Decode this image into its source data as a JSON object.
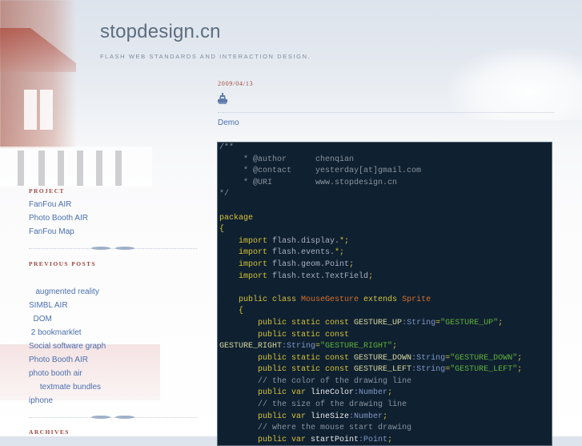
{
  "site": {
    "title": "stopdesign.cn",
    "tagline": "FLASH WEB STANDARDS AND INTERACTION DESIGN."
  },
  "sidebar": {
    "project": {
      "heading": "PROJECT",
      "items": [
        "FanFou AIR",
        "Photo Booth AIR",
        "FanFou Map"
      ]
    },
    "previous_posts": {
      "heading": "PREVIOUS POSTS",
      "items": [
        "   augmented reality",
        "SIMBL AIR",
        "  DOM",
        " 2 bookmarklet",
        "Social software graph",
        "Photo Booth AIR",
        "photo booth air",
        "     textmate bundles",
        "iphone"
      ]
    },
    "archives": {
      "heading": "ARCHIVES"
    }
  },
  "post": {
    "date": "2009/04/13",
    "icon": "pavilion-icon",
    "title": "Demo",
    "code_lines": [
      [
        [
          "comment",
          "/**"
        ]
      ],
      [
        [
          "comment",
          "     * @author      chenqian"
        ]
      ],
      [
        [
          "comment",
          "     * @contact     yesterday[at]gmail.com"
        ]
      ],
      [
        [
          "comment",
          "     * @URI         www.stopdesign.cn"
        ]
      ],
      [
        [
          "comment",
          "*/"
        ]
      ],
      [
        [
          "plain",
          ""
        ]
      ],
      [
        [
          "kw",
          "package"
        ]
      ],
      [
        [
          "punc",
          "{"
        ]
      ],
      [
        [
          "plain",
          "    "
        ],
        [
          "kw",
          "import"
        ],
        [
          "plain",
          " flash.display."
        ],
        [
          "punc",
          "*;"
        ]
      ],
      [
        [
          "plain",
          "    "
        ],
        [
          "kw",
          "import"
        ],
        [
          "plain",
          " flash.events."
        ],
        [
          "punc",
          "*;"
        ]
      ],
      [
        [
          "plain",
          "    "
        ],
        [
          "kw",
          "import"
        ],
        [
          "plain",
          " flash.geom.Point"
        ],
        [
          "punc",
          ";"
        ]
      ],
      [
        [
          "plain",
          "    "
        ],
        [
          "kw",
          "import"
        ],
        [
          "plain",
          " flash.text.TextField"
        ],
        [
          "punc",
          ";"
        ]
      ],
      [
        [
          "plain",
          ""
        ]
      ],
      [
        [
          "plain",
          "    "
        ],
        [
          "kw",
          "public class "
        ],
        [
          "cls",
          "MouseGesture"
        ],
        [
          "kw",
          " extends "
        ],
        [
          "cls",
          "Sprite"
        ]
      ],
      [
        [
          "plain",
          "    "
        ],
        [
          "punc",
          "{"
        ]
      ],
      [
        [
          "plain",
          "        "
        ],
        [
          "kw",
          "public static const "
        ],
        [
          "id",
          "GESTURE_UP"
        ],
        [
          "type",
          ":String"
        ],
        [
          "punc",
          "="
        ],
        [
          "str",
          "\"GESTURE_UP\""
        ],
        [
          "punc",
          ";"
        ]
      ],
      [
        [
          "plain",
          "        "
        ],
        [
          "kw",
          "public static const"
        ]
      ],
      [
        [
          "id",
          "GESTURE_RIGHT"
        ],
        [
          "type",
          ":String"
        ],
        [
          "punc",
          "="
        ],
        [
          "str",
          "\"GESTURE_RIGHT\""
        ],
        [
          "punc",
          ";"
        ]
      ],
      [
        [
          "plain",
          "        "
        ],
        [
          "kw",
          "public static const "
        ],
        [
          "id",
          "GESTURE_DOWN"
        ],
        [
          "type",
          ":String"
        ],
        [
          "punc",
          "="
        ],
        [
          "str",
          "\"GESTURE_DOWN\""
        ],
        [
          "punc",
          ";"
        ]
      ],
      [
        [
          "plain",
          "        "
        ],
        [
          "kw",
          "public static const "
        ],
        [
          "id",
          "GESTURE_LEFT"
        ],
        [
          "type",
          ":String"
        ],
        [
          "punc",
          "="
        ],
        [
          "str",
          "\"GESTURE_LEFT\""
        ],
        [
          "punc",
          ";"
        ]
      ],
      [
        [
          "plain",
          "        "
        ],
        [
          "comment",
          "// the color of the drawing line"
        ]
      ],
      [
        [
          "plain",
          "        "
        ],
        [
          "kw",
          "public var "
        ],
        [
          "ident",
          "lineColor"
        ],
        [
          "type",
          ":Number"
        ],
        [
          "punc",
          ";"
        ]
      ],
      [
        [
          "plain",
          "        "
        ],
        [
          "comment",
          "// the size of the drawing line"
        ]
      ],
      [
        [
          "plain",
          "        "
        ],
        [
          "kw",
          "public var "
        ],
        [
          "ident",
          "lineSize"
        ],
        [
          "type",
          ":Number"
        ],
        [
          "punc",
          ";"
        ]
      ],
      [
        [
          "plain",
          "        "
        ],
        [
          "comment",
          "// where the mouse start drawing"
        ]
      ],
      [
        [
          "plain",
          "        "
        ],
        [
          "kw",
          "public var "
        ],
        [
          "ident",
          "startPoint"
        ],
        [
          "type",
          ":Point"
        ],
        [
          "punc",
          ";"
        ]
      ]
    ]
  },
  "colors": {
    "link": "#4a6fae",
    "heading_accent": "#a0473d",
    "code_bg": "#0f2030"
  }
}
